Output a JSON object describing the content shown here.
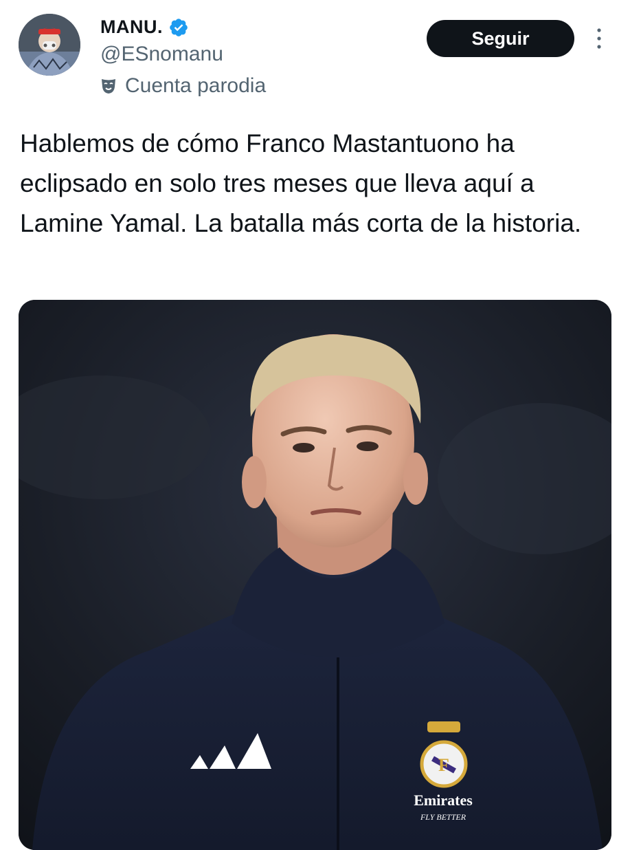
{
  "author": {
    "display_name": "MANU.",
    "handle": "@ESnomanu",
    "account_label": "Cuenta parodia",
    "verified_icon": "verified-badge-icon",
    "label_icon": "theater-masks-icon",
    "avatar_icon": "avatar-image"
  },
  "actions": {
    "follow_label": "Seguir",
    "more_icon": "more-vertical-icon"
  },
  "tweet": {
    "text": "Hablemos de cómo Franco Mastantuono ha eclipsado en solo tres meses que lleva aquí a Lamine Yamal. La batalla más corta de la historia."
  },
  "media": {
    "type": "photo",
    "sponsor_text": "Emirates",
    "sponsor_tagline": "FLY BETTER"
  },
  "colors": {
    "text_primary": "#0f1419",
    "text_secondary": "#536471",
    "verified_blue": "#1d9bf0",
    "button_bg": "#0f1419",
    "button_text": "#ffffff",
    "jacket_navy": "#1a2136"
  }
}
